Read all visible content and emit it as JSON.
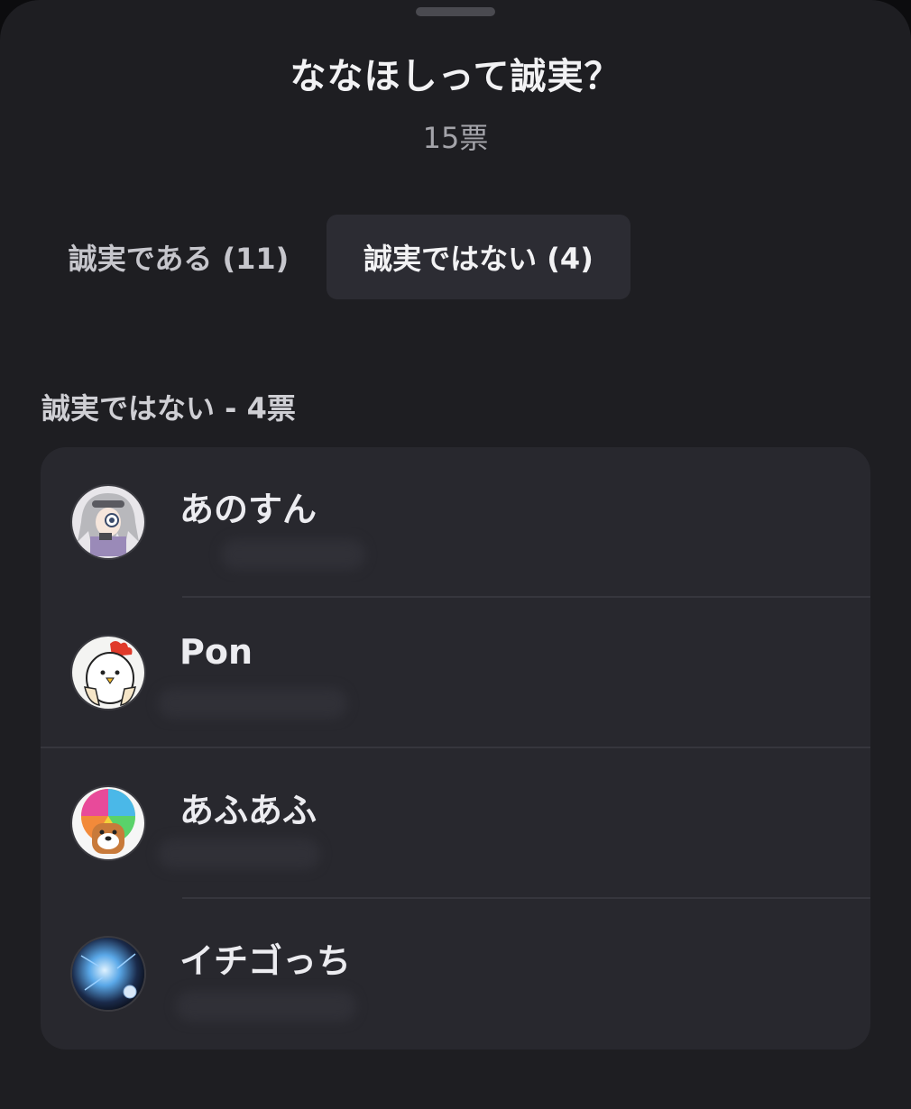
{
  "poll": {
    "question": "ななほしって誠実？",
    "total_votes": "15票"
  },
  "tabs": [
    {
      "label": "誠実である (11)",
      "selected": false
    },
    {
      "label": "誠実ではない (4)",
      "selected": true
    }
  ],
  "section": {
    "label": "誠実ではない - 4票"
  },
  "voters": [
    {
      "name": "あのすん",
      "avatar": "anime-character-avatar"
    },
    {
      "name": "Pon",
      "avatar": "chicken-avatar"
    },
    {
      "name": "あふあふ",
      "avatar": "rainbow-afro-dog-avatar"
    },
    {
      "name": "イチゴっち",
      "avatar": "blue-light-avatar"
    }
  ],
  "colors": {
    "background": "#1e1e22",
    "card": "#28282e",
    "selected_tab": "#2c2c33",
    "text_primary": "#f2f2f4",
    "text_secondary": "#a4a4aa"
  }
}
